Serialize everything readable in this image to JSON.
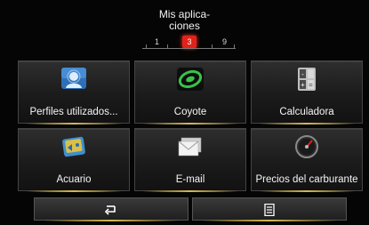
{
  "header": {
    "title": "Mis aplica-\nciones"
  },
  "pager": {
    "first": "1",
    "current": "3",
    "last": "9"
  },
  "apps": [
    {
      "label": "Perfiles utilizados...",
      "icon": "profiles-icon"
    },
    {
      "label": "Coyote",
      "icon": "coyote-icon"
    },
    {
      "label": "Calculadora",
      "icon": "calculator-icon"
    },
    {
      "label": "Acuario",
      "icon": "aquarium-icon"
    },
    {
      "label": "E-mail",
      "icon": "email-icon"
    },
    {
      "label": "Precios del carburante",
      "icon": "fuel-gauge-icon"
    }
  ],
  "bottom_bar": {
    "back_icon": "back-arrow-icon",
    "menu_icon": "menu-list-icon"
  },
  "colors": {
    "accent_red": "#e0231a",
    "gold_line": "#d6b85a"
  }
}
